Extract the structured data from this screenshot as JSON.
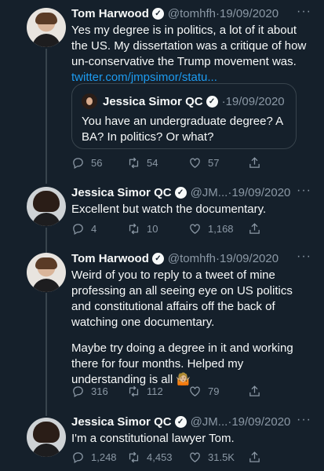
{
  "tweets": [
    {
      "name": "Tom Harwood",
      "handle": "@tomhfh",
      "date": "19/09/2020",
      "text_lines": [
        "Yes my degree is in politics, a lot of it about",
        "the US. My dissertation was a critique of how",
        "un-conservative the Trump movement was."
      ],
      "link": "twitter.com/jmpsimor/statu...",
      "quote": {
        "name": "Jessica Simor QC",
        "date": "19/09/2020",
        "text_lines": [
          "You have an undergraduate degree? A",
          "BA? In politics? Or what?"
        ]
      },
      "replies": "56",
      "retweets": "54",
      "likes": "57"
    },
    {
      "name": "Jessica Simor QC",
      "handle": "@JM...",
      "date": "19/09/2020",
      "text_lines": [
        "Excellent but watch the documentary."
      ],
      "replies": "4",
      "retweets": "10",
      "likes": "1,168"
    },
    {
      "name": "Tom Harwood",
      "handle": "@tomhfh",
      "date": "19/09/2020",
      "text_lines": [
        "Weird of you to reply to a tweet of mine",
        "professing an all seeing eye on US politics",
        "and constitutional affairs off the back of",
        "watching one documentary.",
        "",
        "Maybe try doing a degree in it and working",
        "there for four months. Helped my",
        "understanding is all 🤷🏼"
      ],
      "replies": "316",
      "retweets": "112",
      "likes": "79"
    },
    {
      "name": "Jessica Simor QC",
      "handle": "@JM...",
      "date": "19/09/2020",
      "text_lines": [
        "I'm a constitutional lawyer Tom."
      ],
      "replies": "1,248",
      "retweets": "4,453",
      "likes": "31.5K"
    }
  ],
  "ui": {
    "verified_mark": "✓",
    "more": "···",
    "separator": " · "
  }
}
